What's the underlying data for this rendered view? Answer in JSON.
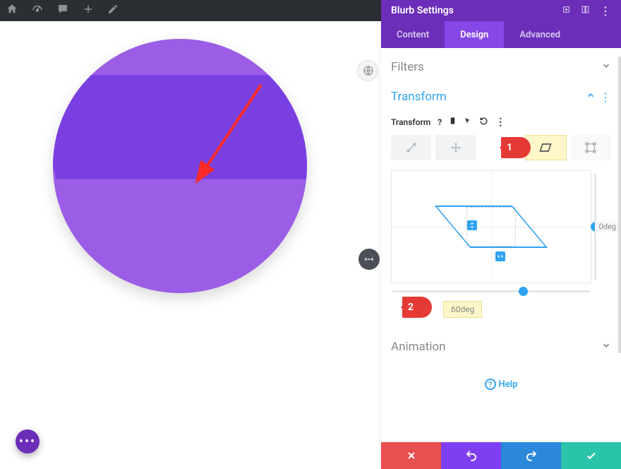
{
  "panel_title": "Blurb Settings",
  "tabs": {
    "content": "Content",
    "design": "Design",
    "advanced": "Advanced",
    "active": "design"
  },
  "sections": {
    "filters": "Filters",
    "transform": "Transform",
    "animation": "Animation"
  },
  "transform": {
    "label": "Transform",
    "y_value": "0deg",
    "x_value": "60deg"
  },
  "callouts": {
    "one": "1",
    "two": "2"
  },
  "help": "Help",
  "fab": "•••",
  "topbar_pink": "✻"
}
